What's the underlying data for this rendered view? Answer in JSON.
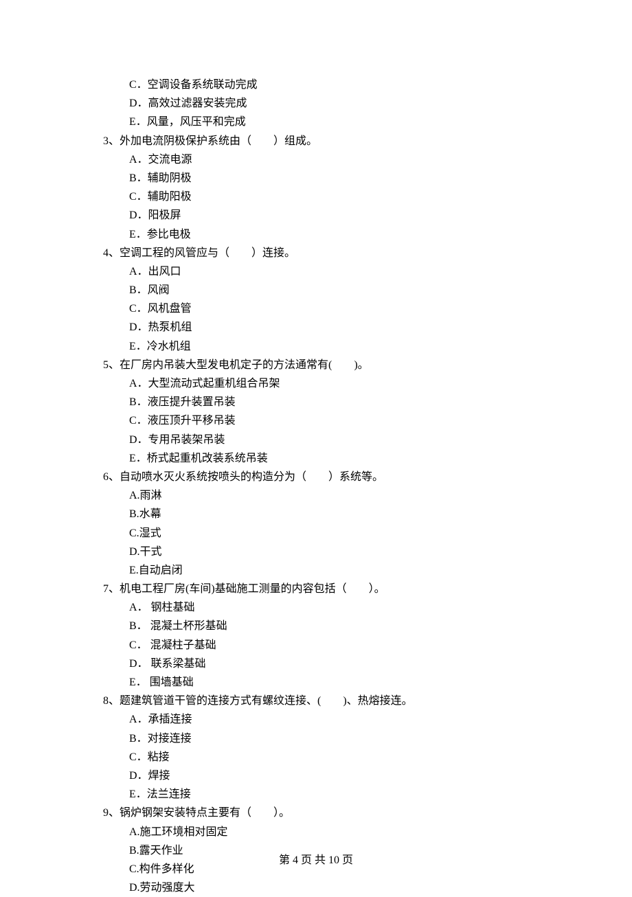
{
  "orphan_options": [
    "C．空调设备系统联动完成",
    "D．高效过滤器安装完成",
    "E．风量，风压平和完成"
  ],
  "questions": [
    {
      "stem": "3、外加电流阴极保护系统由（　　）组成。",
      "options": [
        "A．交流电源",
        "B．辅助阴极",
        "C．辅助阳极",
        "D．阳极屏",
        "E．参比电极"
      ]
    },
    {
      "stem": "4、空调工程的风管应与（　　）连接。",
      "options": [
        "A．出风口",
        "B．风阀",
        "C．风机盘管",
        "D．热泵机组",
        "E．冷水机组"
      ]
    },
    {
      "stem": "5、在厂房内吊装大型发电机定子的方法通常有(　　)。",
      "options": [
        "A．大型流动式起重机组合吊架",
        "B．液压提升装置吊装",
        "C．液压顶升平移吊装",
        "D．专用吊装架吊装",
        "E．桥式起重机改装系统吊装"
      ]
    },
    {
      "stem": "6、自动喷水灭火系统按喷头的构造分为（　　）系统等。",
      "options": [
        "A.雨淋",
        "B.水幕",
        "C.湿式",
        "D.干式",
        "E.自动启闭"
      ]
    },
    {
      "stem": "7、机电工程厂房(车间)基础施工测量的内容包括（　　）。",
      "options": [
        "A． 钢柱基础",
        "B． 混凝土杯形基础",
        "C． 混凝柱子基础",
        "D． 联系梁基础",
        "E． 围墙基础"
      ]
    },
    {
      "stem": "8、题建筑管道干管的连接方式有螺纹连接、(　　)、热熔接连。",
      "options": [
        "A．承插连接",
        "B．对接连接",
        "C．粘接",
        "D．焊接",
        "E．法兰连接"
      ]
    },
    {
      "stem": "9、锅炉钢架安装特点主要有（　　）。",
      "options": [
        "A.施工环境相对固定",
        "B.露天作业",
        "C.构件多样化",
        "D.劳动强度大"
      ]
    }
  ],
  "footer": "第 4 页 共 10 页"
}
